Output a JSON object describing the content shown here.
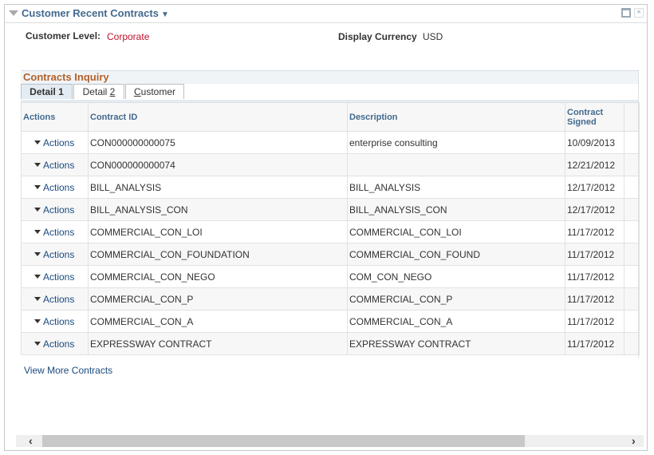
{
  "pagelet": {
    "title": "Customer Recent Contracts",
    "title_caret": "▼",
    "collapse_icon": "triangle-down",
    "maximize_icon": "maximize-box",
    "close_icon": "×"
  },
  "fields": {
    "customer_level_label": "Customer Level:",
    "customer_level_value": "Corporate",
    "display_currency_label": "Display Currency",
    "display_currency_value": "USD"
  },
  "grid": {
    "title": "Contracts Inquiry",
    "tabs": [
      {
        "label_pre": "Detail 1",
        "label_ul": "",
        "label_post": "",
        "active": true
      },
      {
        "label_pre": "Detail ",
        "label_ul": "2",
        "label_post": "",
        "active": false
      },
      {
        "label_pre": "",
        "label_ul": "C",
        "label_post": "ustomer",
        "active": false
      }
    ],
    "columns": [
      "Actions",
      "Contract ID",
      "Description",
      "Contract Signed"
    ],
    "rows": [
      {
        "action": "Actions",
        "contract_id": "CON000000000075",
        "description": "enterprise consulting",
        "signed": "10/09/2013"
      },
      {
        "action": "Actions",
        "contract_id": "CON000000000074",
        "description": "",
        "signed": "12/21/2012"
      },
      {
        "action": "Actions",
        "contract_id": "BILL_ANALYSIS",
        "description": "BILL_ANALYSIS",
        "signed": "12/17/2012"
      },
      {
        "action": "Actions",
        "contract_id": "BILL_ANALYSIS_CON",
        "description": "BILL_ANALYSIS_CON",
        "signed": "12/17/2012"
      },
      {
        "action": "Actions",
        "contract_id": "COMMERCIAL_CON_LOI",
        "description": "COMMERCIAL_CON_LOI",
        "signed": "11/17/2012"
      },
      {
        "action": "Actions",
        "contract_id": "COMMERCIAL_CON_FOUNDATION",
        "description": "COMMERCIAL_CON_FOUND",
        "signed": "11/17/2012"
      },
      {
        "action": "Actions",
        "contract_id": "COMMERCIAL_CON_NEGO",
        "description": "COM_CON_NEGO",
        "signed": "11/17/2012"
      },
      {
        "action": "Actions",
        "contract_id": "COMMERCIAL_CON_P",
        "description": "COMMERCIAL_CON_P",
        "signed": "11/17/2012"
      },
      {
        "action": "Actions",
        "contract_id": "COMMERCIAL_CON_A",
        "description": "COMMERCIAL_CON_A",
        "signed": "11/17/2012"
      },
      {
        "action": "Actions",
        "contract_id": "EXPRESSWAY CONTRACT",
        "description": "EXPRESSWAY CONTRACT",
        "signed": "11/17/2012"
      }
    ]
  },
  "links": {
    "view_more": "View More Contracts"
  },
  "scrollbar": {
    "left_arrow": "‹",
    "right_arrow": "›",
    "position_fraction": 0.0,
    "visible_fraction": 0.78
  },
  "colors": {
    "title": "#426a8f",
    "corporate": "#c0102c",
    "grid_title": "#b2622b",
    "link": "#1a4a7e"
  }
}
